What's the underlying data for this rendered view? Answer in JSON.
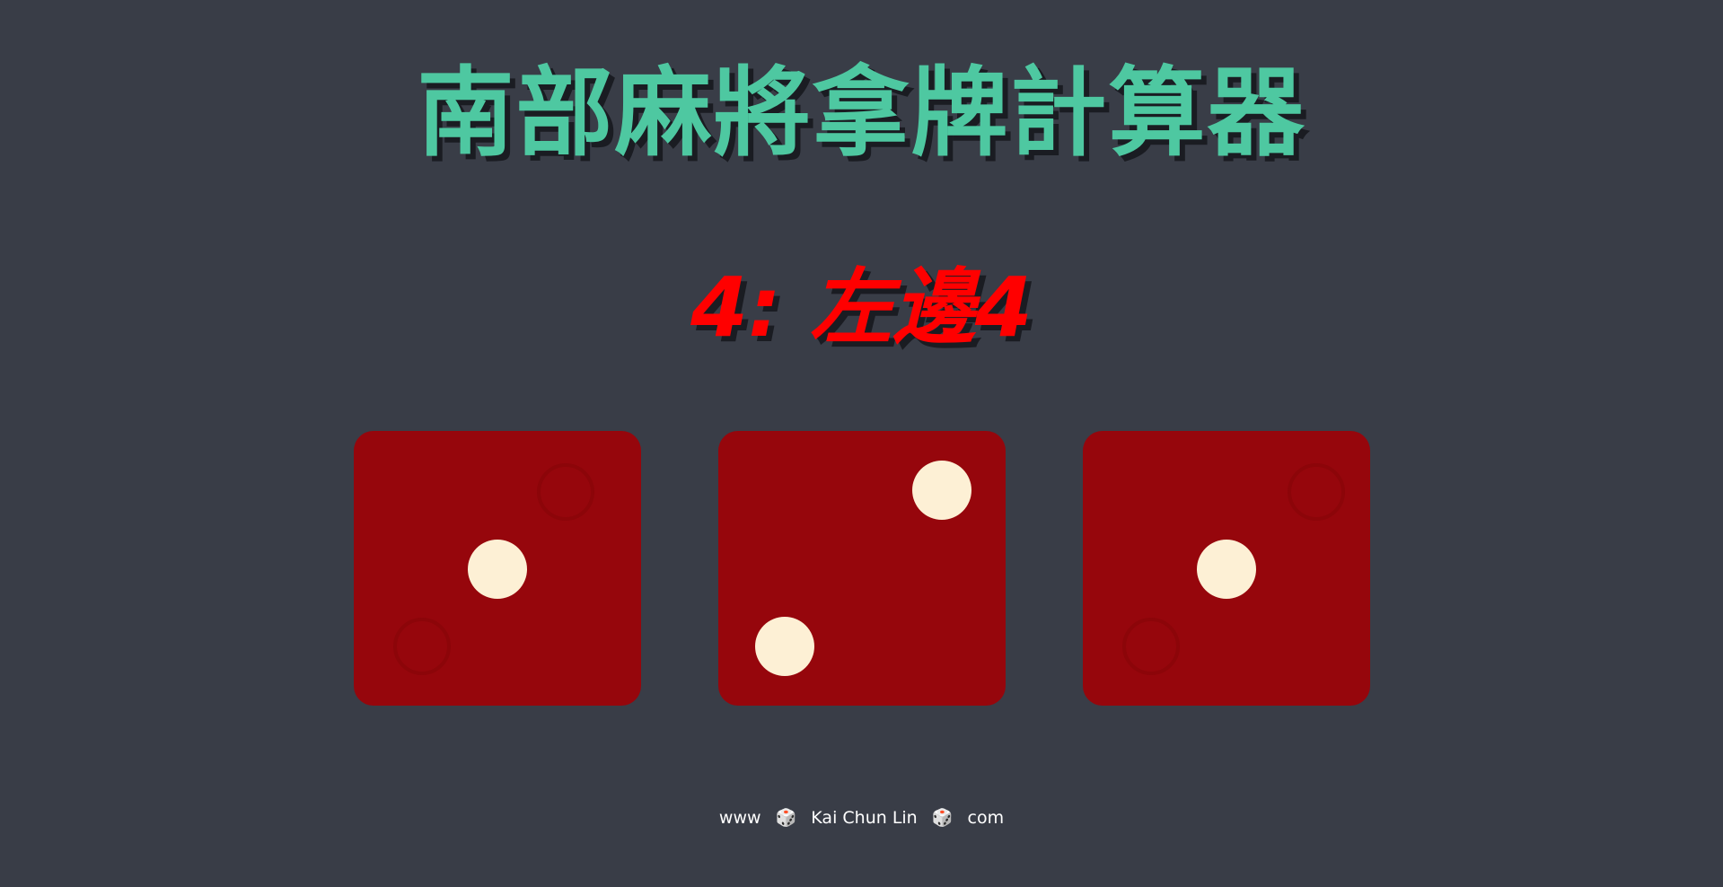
{
  "header": {
    "title": "南部麻將拿牌計算器"
  },
  "result": {
    "text": "4: 左邊4"
  },
  "dice": [
    {
      "value": 1
    },
    {
      "value": 2
    },
    {
      "value": 1
    }
  ],
  "colors": {
    "background": "#393d47",
    "title": "#4ec8a1",
    "result": "#ff0000",
    "die_face": "#96060c",
    "pip": "#fdf0d5"
  },
  "footer": {
    "prefix": "www",
    "name": "Kai Chun Lin",
    "suffix": "com",
    "separator_icon": "dice-icon",
    "separator_glyph": "🎲"
  }
}
